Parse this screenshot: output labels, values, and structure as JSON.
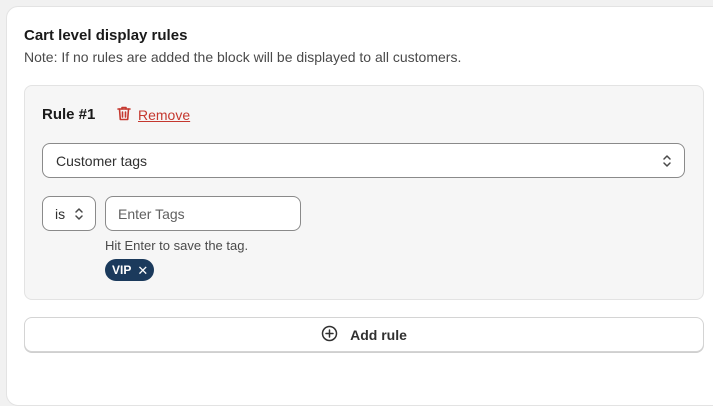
{
  "section": {
    "title": "Cart level display rules",
    "note": "Note: If no rules are added the block will be displayed to all customers."
  },
  "rule": {
    "title": "Rule #1",
    "remove_label": "Remove",
    "condition_type": "Customer tags",
    "operator": "is",
    "tags_placeholder": "Enter Tags",
    "help_text": "Hit Enter to save the tag.",
    "tags": [
      "VIP"
    ]
  },
  "add_rule_label": "Add rule",
  "icons": {
    "remove": "trash-icon",
    "select": "chevron-up-down-icon",
    "tag_close": "close-icon",
    "add_rule": "plus-circle-icon"
  },
  "colors": {
    "danger": "#c5382f",
    "tag_background": "#1b3a5c"
  }
}
